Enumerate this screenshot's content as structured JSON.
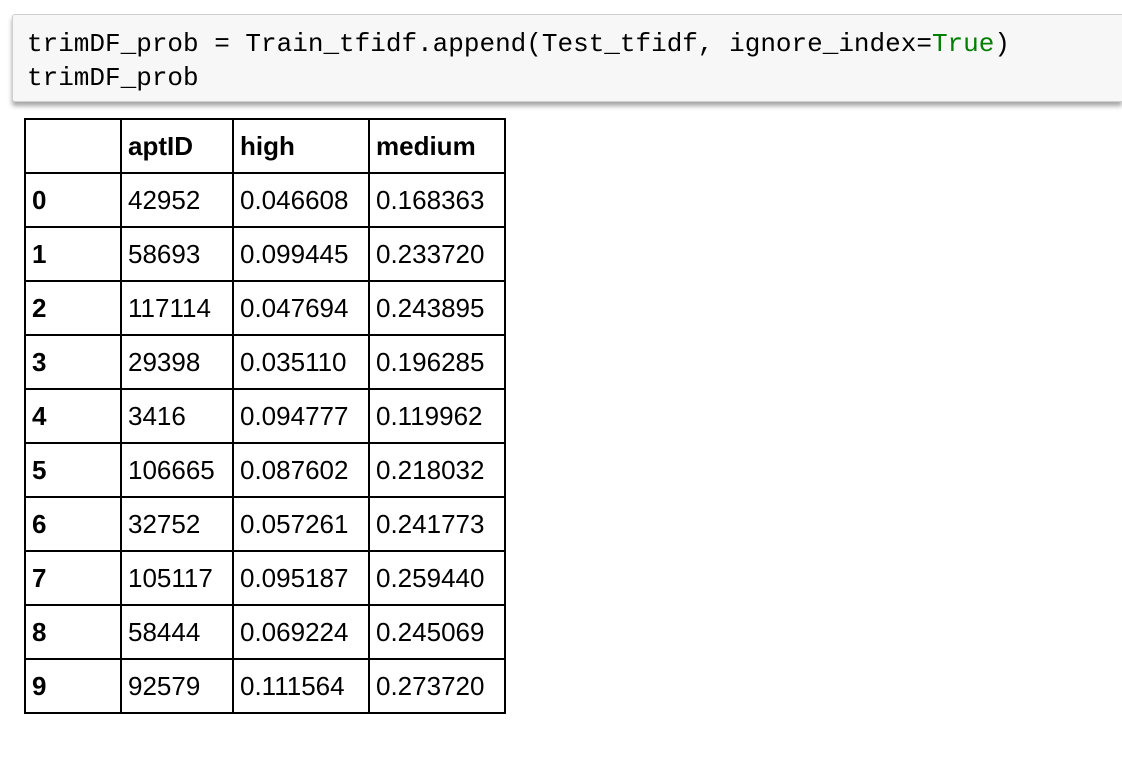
{
  "code_cell": {
    "line1_prefix": "trimDF_prob = Train_tfidf.append(Test_tfidf, ignore_index=",
    "line1_keyword": "True",
    "line1_suffix": ")",
    "line2": "trimDF_prob",
    "colors": {
      "keyword": "#008000",
      "cell_background": "#f7f7f7"
    }
  },
  "output_table": {
    "columns": [
      "",
      "aptID",
      "high",
      "medium"
    ],
    "rows": [
      {
        "index": "0",
        "aptID": "42952",
        "high": "0.046608",
        "medium": "0.168363"
      },
      {
        "index": "1",
        "aptID": "58693",
        "high": "0.099445",
        "medium": "0.233720"
      },
      {
        "index": "2",
        "aptID": "117114",
        "high": "0.047694",
        "medium": "0.243895"
      },
      {
        "index": "3",
        "aptID": "29398",
        "high": "0.035110",
        "medium": "0.196285"
      },
      {
        "index": "4",
        "aptID": "3416",
        "high": "0.094777",
        "medium": "0.119962"
      },
      {
        "index": "5",
        "aptID": "106665",
        "high": "0.087602",
        "medium": "0.218032"
      },
      {
        "index": "6",
        "aptID": "32752",
        "high": "0.057261",
        "medium": "0.241773"
      },
      {
        "index": "7",
        "aptID": "105117",
        "high": "0.095187",
        "medium": "0.259440"
      },
      {
        "index": "8",
        "aptID": "58444",
        "high": "0.069224",
        "medium": "0.245069"
      },
      {
        "index": "9",
        "aptID": "92579",
        "high": "0.111564",
        "medium": "0.273720"
      }
    ]
  }
}
